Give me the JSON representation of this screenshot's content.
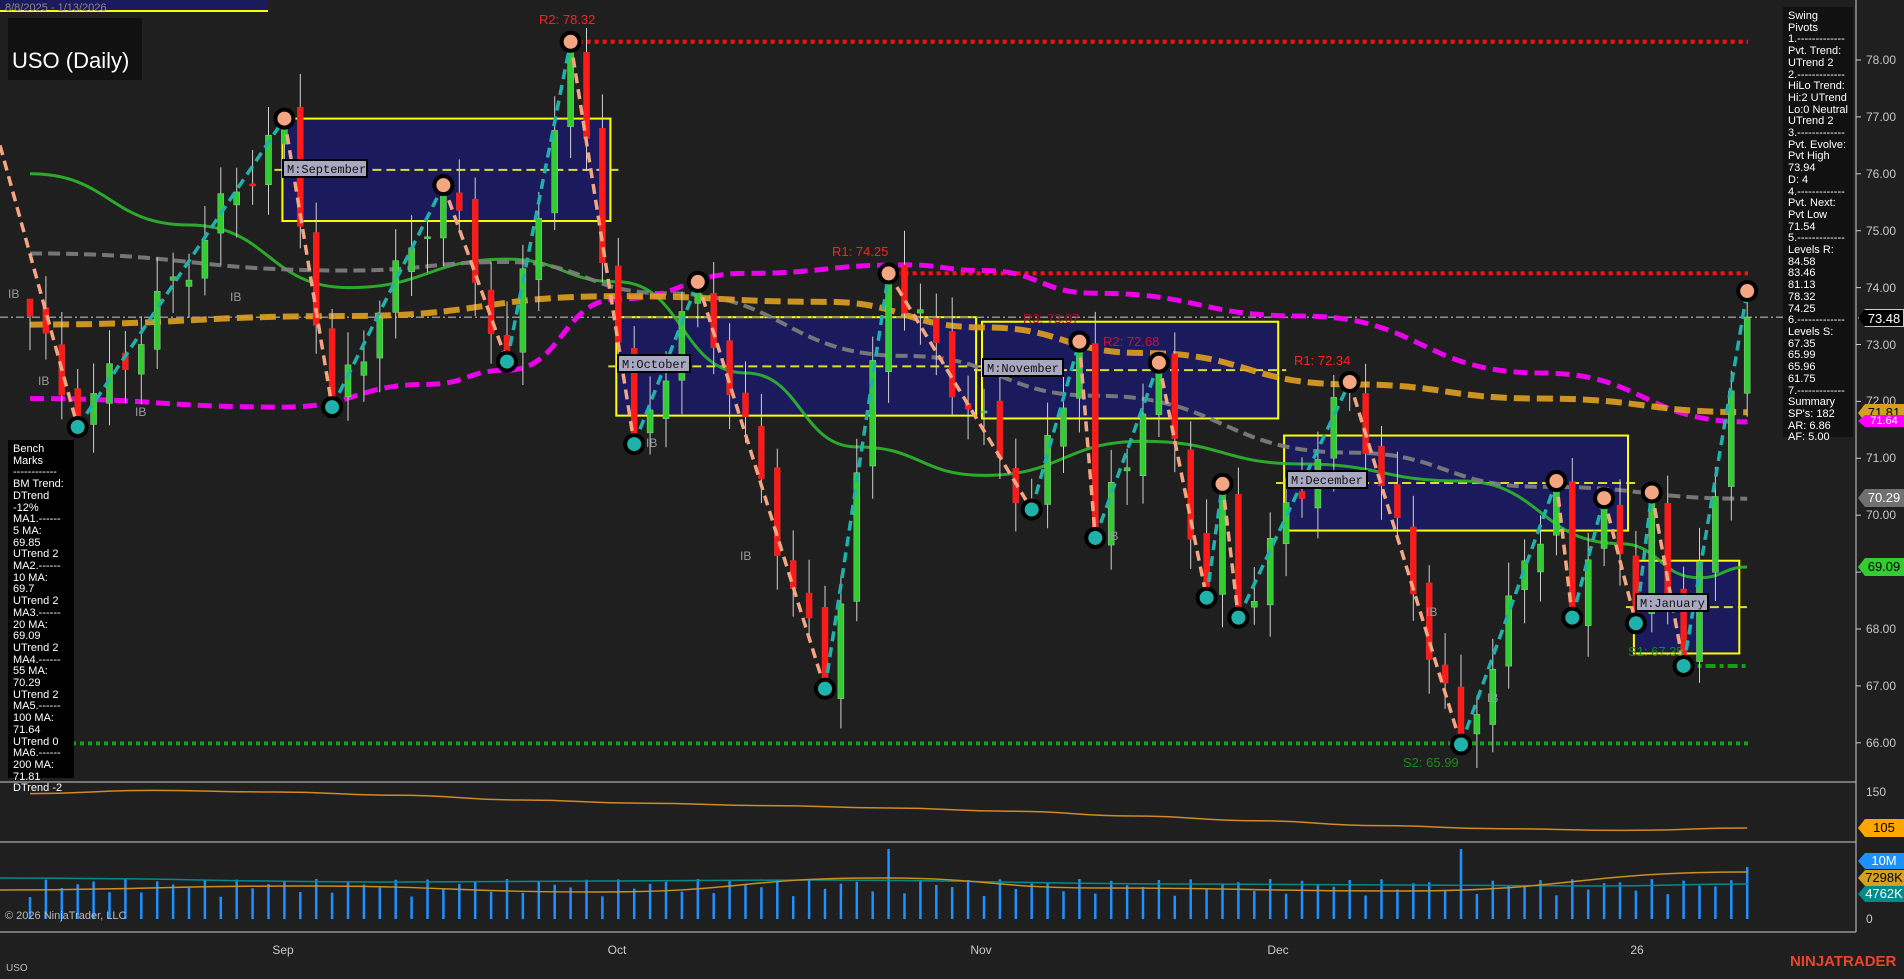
{
  "header": {
    "date_range": "8/8/2025 - 1/13/2026",
    "title": "USO (Daily)"
  },
  "bench_marks": {
    "lines": [
      "Bench Marks",
      "------------",
      "BM Trend:",
      "DTrend -12%",
      "MA1.------",
      "5 MA:",
      "69.85",
      "UTrend 2",
      "MA2.------",
      "10 MA:",
      "69.7",
      "UTrend 2",
      "MA3.------",
      "20 MA:",
      "69.09",
      "UTrend 2",
      "MA4.------",
      "55 MA:",
      "70.29",
      "UTrend 2",
      "MA5.------",
      "100 MA:",
      "71.64",
      "UTrend 0",
      "MA6.------",
      "200 MA:",
      "71.81",
      "DTrend -2"
    ]
  },
  "swing_pivots": {
    "lines": [
      "Swing Pivots",
      "1.-------------",
      "Pvt. Trend:",
      "UTrend 2",
      "2.-------------",
      "HiLo Trend:",
      "Hi:2 UTrend",
      "Lo:0 Neutral",
      "UTrend 2",
      "3.-------------",
      "Pvt. Evolve:",
      "Pvt High",
      "73.94",
      "D: 4",
      "4.-------------",
      "Pvt. Next:",
      "Pvt Low",
      "71.54",
      "5.-------------",
      "Levels R:",
      "84.58",
      "83.46",
      "81.13",
      "78.32",
      "74.25",
      "6.-------------",
      "Levels S:",
      "67.35",
      "65.99",
      "65.96",
      "61.75",
      "7.-------------",
      "Summary",
      "SP's: 182",
      "AR: 6.86",
      "AF: 5.00"
    ]
  },
  "price_axis": {
    "ticks": [
      "78.00",
      "77.00",
      "76.00",
      "75.00",
      "74.00",
      "73.00",
      "72.00",
      "71.00",
      "70.00",
      "69.00",
      "68.00",
      "67.00",
      "66.00"
    ]
  },
  "indicator_axis": {
    "ticks": [
      "150"
    ]
  },
  "volume_axis": {
    "ticks": [
      "0"
    ]
  },
  "tags": {
    "last_price": "73.48",
    "ma200": "71.81",
    "ma100": "71.64",
    "ma55": "70.29",
    "ma20": "69.09",
    "indicator": "105",
    "volume": "10M",
    "volume_ma1": "7298K",
    "volume_ma2": "4762K"
  },
  "date_axis": {
    "labels": [
      "Sep",
      "Oct",
      "Nov",
      "Dec",
      "26"
    ]
  },
  "footer": {
    "copyright": "© 2026 NinjaTrader, LLC",
    "symbol": "USO",
    "brand": "NINJATRADER"
  },
  "level_labels": {
    "r2_a": "R2: 78.32",
    "r1_a": "R1: 74.25",
    "r3_b": "R3: 73.07",
    "r2_b": "R2: 72.68",
    "r1_b": "R1: 72.34",
    "s1": "S1: 67.35",
    "s2": "S2: 65.99"
  },
  "month_labels": {
    "sep": "M:September",
    "oct": "M:October",
    "nov": "M:November",
    "dec": "M:December",
    "jan": "M:January"
  },
  "ib_label": "IB",
  "colors": {
    "up": "#33cc33",
    "down": "#ff1a1a",
    "ma20": "#2db82d",
    "ma55": "#808080",
    "ma100": "#ff00ff",
    "ma200": "#e0a020",
    "zig_up": "#20b2aa",
    "zig_down": "#f4a582",
    "box_fill": "#1a1a5c",
    "box_border": "#ffff00"
  },
  "chart_data": {
    "type": "candlestick",
    "title": "USO (Daily)",
    "x_range": [
      "8/8/2025",
      "1/13/2026"
    ],
    "ylim": [
      65.5,
      78.6
    ],
    "bars": 109,
    "swing_pivots": [
      [
        0,
        73.5
      ],
      [
        3,
        71.55
      ],
      [
        16,
        76.97
      ],
      [
        19,
        71.9
      ],
      [
        26,
        75.8
      ],
      [
        30,
        72.7
      ],
      [
        34,
        78.32
      ],
      [
        38,
        71.25
      ],
      [
        42,
        74.1
      ],
      [
        50,
        66.95
      ],
      [
        54,
        74.25
      ],
      [
        63,
        70.1
      ],
      [
        66,
        73.05
      ],
      [
        67,
        69.6
      ],
      [
        71,
        72.68
      ],
      [
        74,
        68.55
      ],
      [
        75,
        70.55
      ],
      [
        76,
        68.2
      ],
      [
        83,
        72.34
      ],
      [
        90,
        65.97
      ],
      [
        96,
        70.6
      ],
      [
        97,
        68.2
      ],
      [
        99,
        70.3
      ],
      [
        101,
        68.1
      ],
      [
        102,
        70.4
      ],
      [
        104,
        67.35
      ],
      [
        108,
        73.94
      ]
    ],
    "last_close": 73.48,
    "moving_averages": [
      {
        "name": "20 MA",
        "points": [
          [
            0,
            76.0
          ],
          [
            10,
            75.1
          ],
          [
            20,
            74.0
          ],
          [
            30,
            74.5
          ],
          [
            37,
            74.1
          ],
          [
            45,
            72.5
          ],
          [
            52,
            71.2
          ],
          [
            60,
            70.7
          ],
          [
            70,
            71.3
          ],
          [
            80,
            70.9
          ],
          [
            90,
            70.6
          ],
          [
            100,
            69.5
          ],
          [
            105,
            68.9
          ],
          [
            108,
            69.09
          ]
        ]
      },
      {
        "name": "55 MA",
        "points": [
          [
            0,
            74.6
          ],
          [
            20,
            74.3
          ],
          [
            30,
            74.45
          ],
          [
            40,
            73.9
          ],
          [
            55,
            72.8
          ],
          [
            67,
            72.1
          ],
          [
            83,
            71.1
          ],
          [
            95,
            70.5
          ],
          [
            108,
            70.29
          ]
        ]
      },
      {
        "name": "100 MA",
        "points": [
          [
            0,
            72.05
          ],
          [
            16,
            71.9
          ],
          [
            25,
            72.3
          ],
          [
            30,
            72.55
          ],
          [
            37,
            73.8
          ],
          [
            45,
            74.25
          ],
          [
            55,
            74.4
          ],
          [
            60,
            74.3
          ],
          [
            67,
            73.9
          ],
          [
            80,
            73.5
          ],
          [
            95,
            72.5
          ],
          [
            108,
            71.64
          ]
        ]
      },
      {
        "name": "200 MA",
        "points": [
          [
            0,
            73.35
          ],
          [
            20,
            73.5
          ],
          [
            37,
            73.85
          ],
          [
            50,
            73.75
          ],
          [
            60,
            73.3
          ],
          [
            70,
            72.85
          ],
          [
            83,
            72.3
          ],
          [
            95,
            72.05
          ],
          [
            108,
            71.81
          ]
        ]
      }
    ],
    "resistance_levels": [
      {
        "label": "R2",
        "value": 78.32,
        "from": 34
      },
      {
        "label": "R1",
        "value": 74.25,
        "from": 54
      }
    ],
    "support_levels": [
      {
        "label": "S1",
        "value": 67.35,
        "from": 104
      },
      {
        "label": "S2",
        "value": 65.99,
        "from": 0
      }
    ],
    "monthly_boxes": [
      {
        "month": "September",
        "from": 16,
        "to": 36,
        "high": 76.97,
        "low": 75.17
      },
      {
        "month": "October",
        "from": 37,
        "to": 59,
        "high": 73.48,
        "low": 71.75
      },
      {
        "month": "November",
        "from": 60,
        "to": 78,
        "high": 73.4,
        "low": 71.7
      },
      {
        "month": "December",
        "from": 79,
        "to": 100,
        "high": 71.4,
        "low": 69.73
      },
      {
        "month": "January",
        "from": 101,
        "to": 107,
        "high": 69.2,
        "low": 67.57
      }
    ],
    "indicator": {
      "ylim": [
        100,
        160
      ],
      "values": [
        148,
        152,
        150,
        146,
        140,
        136,
        133,
        130,
        126,
        120,
        114,
        108,
        104,
        102,
        105
      ]
    },
    "volume": {
      "last": "10M",
      "ma1": "7298K",
      "ma2": "4762K"
    }
  }
}
